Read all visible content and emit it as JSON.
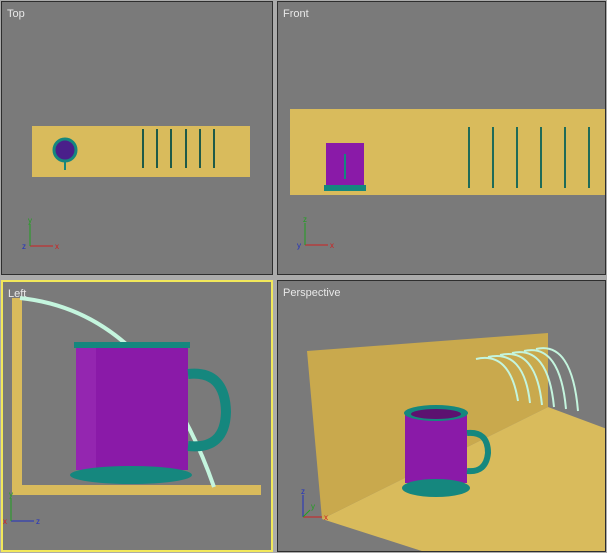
{
  "viewports": {
    "top": {
      "label": "Top"
    },
    "front": {
      "label": "Front"
    },
    "left": {
      "label": "Left"
    },
    "perspective": {
      "label": "Perspective"
    }
  },
  "axis_labels": {
    "x": "x",
    "y": "y",
    "z": "z"
  },
  "colors": {
    "viewport_bg": "#7a7a7a",
    "active_border": "#f2e85a",
    "shelf": "#d9bb5c",
    "mug": "#8a1aa8",
    "mug_trim": "#15877e",
    "rack_wire": "#b8f0d8"
  }
}
